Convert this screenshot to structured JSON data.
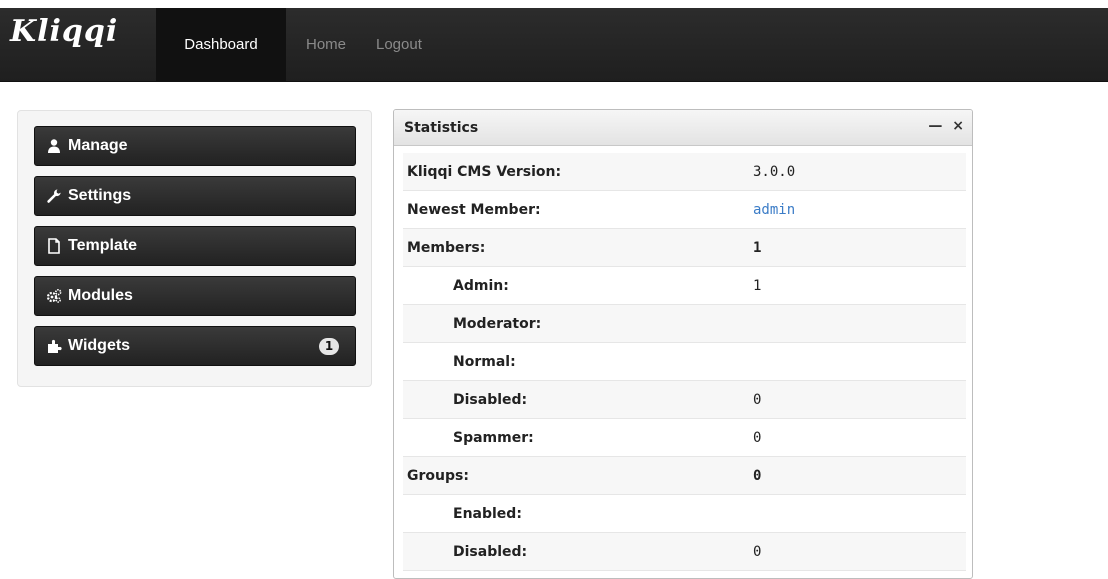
{
  "brand": {
    "name": "Kliqqi"
  },
  "nav": {
    "items": [
      {
        "label": "Dashboard",
        "active": true
      },
      {
        "label": "Home",
        "active": false
      },
      {
        "label": "Logout",
        "active": false
      }
    ]
  },
  "sidebar": {
    "items": [
      {
        "label": "Manage",
        "icon": "user-icon"
      },
      {
        "label": "Settings",
        "icon": "wrench-icon"
      },
      {
        "label": "Template",
        "icon": "file-icon"
      },
      {
        "label": "Modules",
        "icon": "cogs-icon"
      },
      {
        "label": "Widgets",
        "icon": "puzzle-icon",
        "badge": "1"
      }
    ]
  },
  "statistics": {
    "title": "Statistics",
    "rows": [
      {
        "label": "Kliqqi CMS Version:",
        "value": "3.0.0"
      },
      {
        "label": "Newest Member:",
        "value": "admin"
      },
      {
        "label": "Members:",
        "value": "1"
      },
      {
        "label": "Admin:",
        "value": "1"
      },
      {
        "label": "Moderator:",
        "value": ""
      },
      {
        "label": "Normal:",
        "value": ""
      },
      {
        "label": "Disabled:",
        "value": "0"
      },
      {
        "label": "Spammer:",
        "value": "0"
      },
      {
        "label": "Groups:",
        "value": "0"
      },
      {
        "label": "Enabled:",
        "value": ""
      },
      {
        "label": "Disabled:",
        "value": "0"
      }
    ]
  },
  "colors": {
    "topbar": "#242424",
    "link": "#3b7cc7",
    "sidebar_bg": "#f5f5f5"
  }
}
